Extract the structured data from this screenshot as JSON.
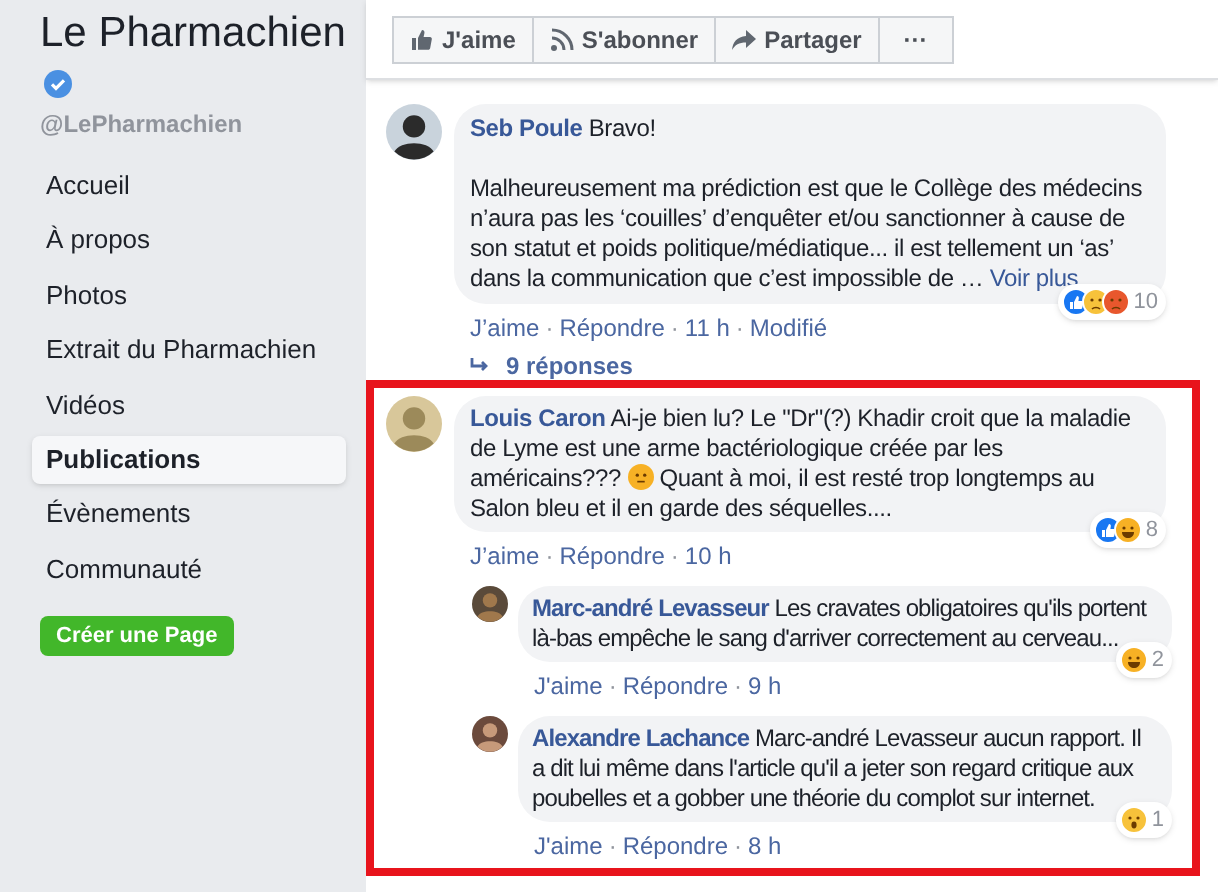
{
  "sidebar": {
    "page_name": "Le Pharmachien",
    "verified": true,
    "handle": "@LePharmachien",
    "items": [
      {
        "label": "Accueil",
        "selected": false
      },
      {
        "label": "À propos",
        "selected": false
      },
      {
        "label": "Photos",
        "selected": false
      },
      {
        "label": "Extrait du Pharmachien",
        "selected": false
      },
      {
        "label": "Vidéos",
        "selected": false
      },
      {
        "label": "Publications",
        "selected": true
      },
      {
        "label": "Évènements",
        "selected": false
      },
      {
        "label": "Communauté",
        "selected": false
      }
    ],
    "create_button": "Créer une Page"
  },
  "action_separator": "·",
  "toolbar": [
    {
      "kind": "like",
      "label": "J'aime"
    },
    {
      "kind": "follow",
      "label": "S'abonner"
    },
    {
      "kind": "share",
      "label": "Partager"
    },
    {
      "kind": "more",
      "label": "···"
    }
  ],
  "comments": [
    {
      "author": "Seb Poule",
      "text": "Bravo!",
      "body": "Malheureusement ma prédiction est que le Collège des médecins n’aura pas les ‘couilles’ d’enquêter et/ou sanctionner à cause de son statut et poids politique/médiatique... il est tellement un ‘as’ dans la communication que c’est impossible de …",
      "see_more": "Voir plus",
      "actions": [
        "J’aime",
        "Répondre",
        "11 h",
        "Modifié"
      ],
      "reactions": [
        {
          "kind": "like"
        },
        {
          "kind": "sad"
        },
        {
          "kind": "angry"
        }
      ],
      "reaction_count": "10",
      "replies_link": "9 réponses"
    }
  ],
  "highlighted_thread": {
    "highlighted": true,
    "comment": {
      "author": "Louis Caron",
      "text": "Ai-je bien lu? Le \"Dr\"(?) Khadir croit que la maladie de Lyme est une arme bactériologique créée par les américains???",
      "emoji": true,
      "text_after": "Quant à moi, il est resté trop longtemps au Salon bleu et il en garde des séquelles....",
      "actions": [
        "J’aime",
        "Répondre",
        "10 h"
      ],
      "reactions": [
        {
          "kind": "like"
        },
        {
          "kind": "haha"
        }
      ],
      "reaction_count": "8"
    },
    "replies": [
      {
        "author": "Marc-andré Levasseur",
        "text": "Les cravates obligatoires qu'ils portent là-bas empêche le sang d'arriver correctement au cerveau...",
        "actions": [
          "J'aime",
          "Répondre",
          "9 h"
        ],
        "reactions": [
          {
            "kind": "haha"
          }
        ],
        "reaction_count": "2"
      },
      {
        "author": "Alexandre Lachance",
        "text": "Marc-andré Levasseur aucun rapport. Il a dit lui même dans l'article qu'il a jeter son regard critique aux poubelles et a gobber une théorie du complot sur internet.",
        "actions": [
          "J'aime",
          "Répondre",
          "8 h"
        ],
        "reactions": [
          {
            "kind": "wow"
          }
        ],
        "reaction_count": "1"
      }
    ]
  }
}
